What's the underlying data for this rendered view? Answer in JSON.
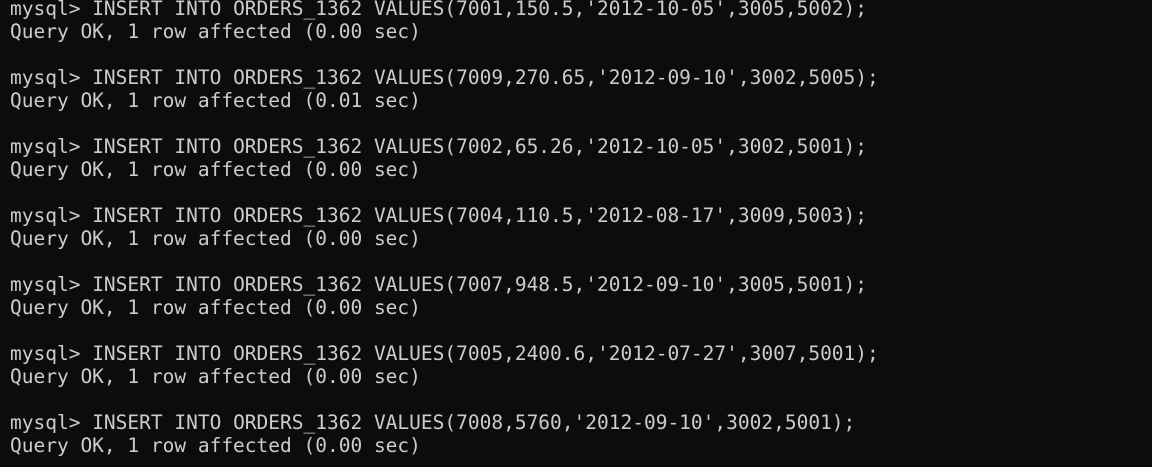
{
  "terminal": {
    "blocks": [
      {
        "prompt": "mysql> ",
        "command": "INSERT INTO ORDERS_1362 VALUES(7001,150.5,'2012-10-05',3005,5002);",
        "result": "Query OK, 1 row affected (0.00 sec)"
      },
      {
        "prompt": "mysql> ",
        "command": "INSERT INTO ORDERS_1362 VALUES(7009,270.65,'2012-09-10',3002,5005);",
        "result": "Query OK, 1 row affected (0.01 sec)"
      },
      {
        "prompt": "mysql> ",
        "command": "INSERT INTO ORDERS_1362 VALUES(7002,65.26,'2012-10-05',3002,5001);",
        "result": "Query OK, 1 row affected (0.00 sec)"
      },
      {
        "prompt": "mysql> ",
        "command": "INSERT INTO ORDERS_1362 VALUES(7004,110.5,'2012-08-17',3009,5003);",
        "result": "Query OK, 1 row affected (0.00 sec)"
      },
      {
        "prompt": "mysql> ",
        "command": "INSERT INTO ORDERS_1362 VALUES(7007,948.5,'2012-09-10',3005,5001);",
        "result": "Query OK, 1 row affected (0.00 sec)"
      },
      {
        "prompt": "mysql> ",
        "command": "INSERT INTO ORDERS_1362 VALUES(7005,2400.6,'2012-07-27',3007,5001);",
        "result": "Query OK, 1 row affected (0.00 sec)"
      },
      {
        "prompt": "mysql> ",
        "command": "INSERT INTO ORDERS_1362 VALUES(7008,5760,'2012-09-10',3002,5001);",
        "result": "Query OK, 1 row affected (0.00 sec)"
      }
    ]
  }
}
